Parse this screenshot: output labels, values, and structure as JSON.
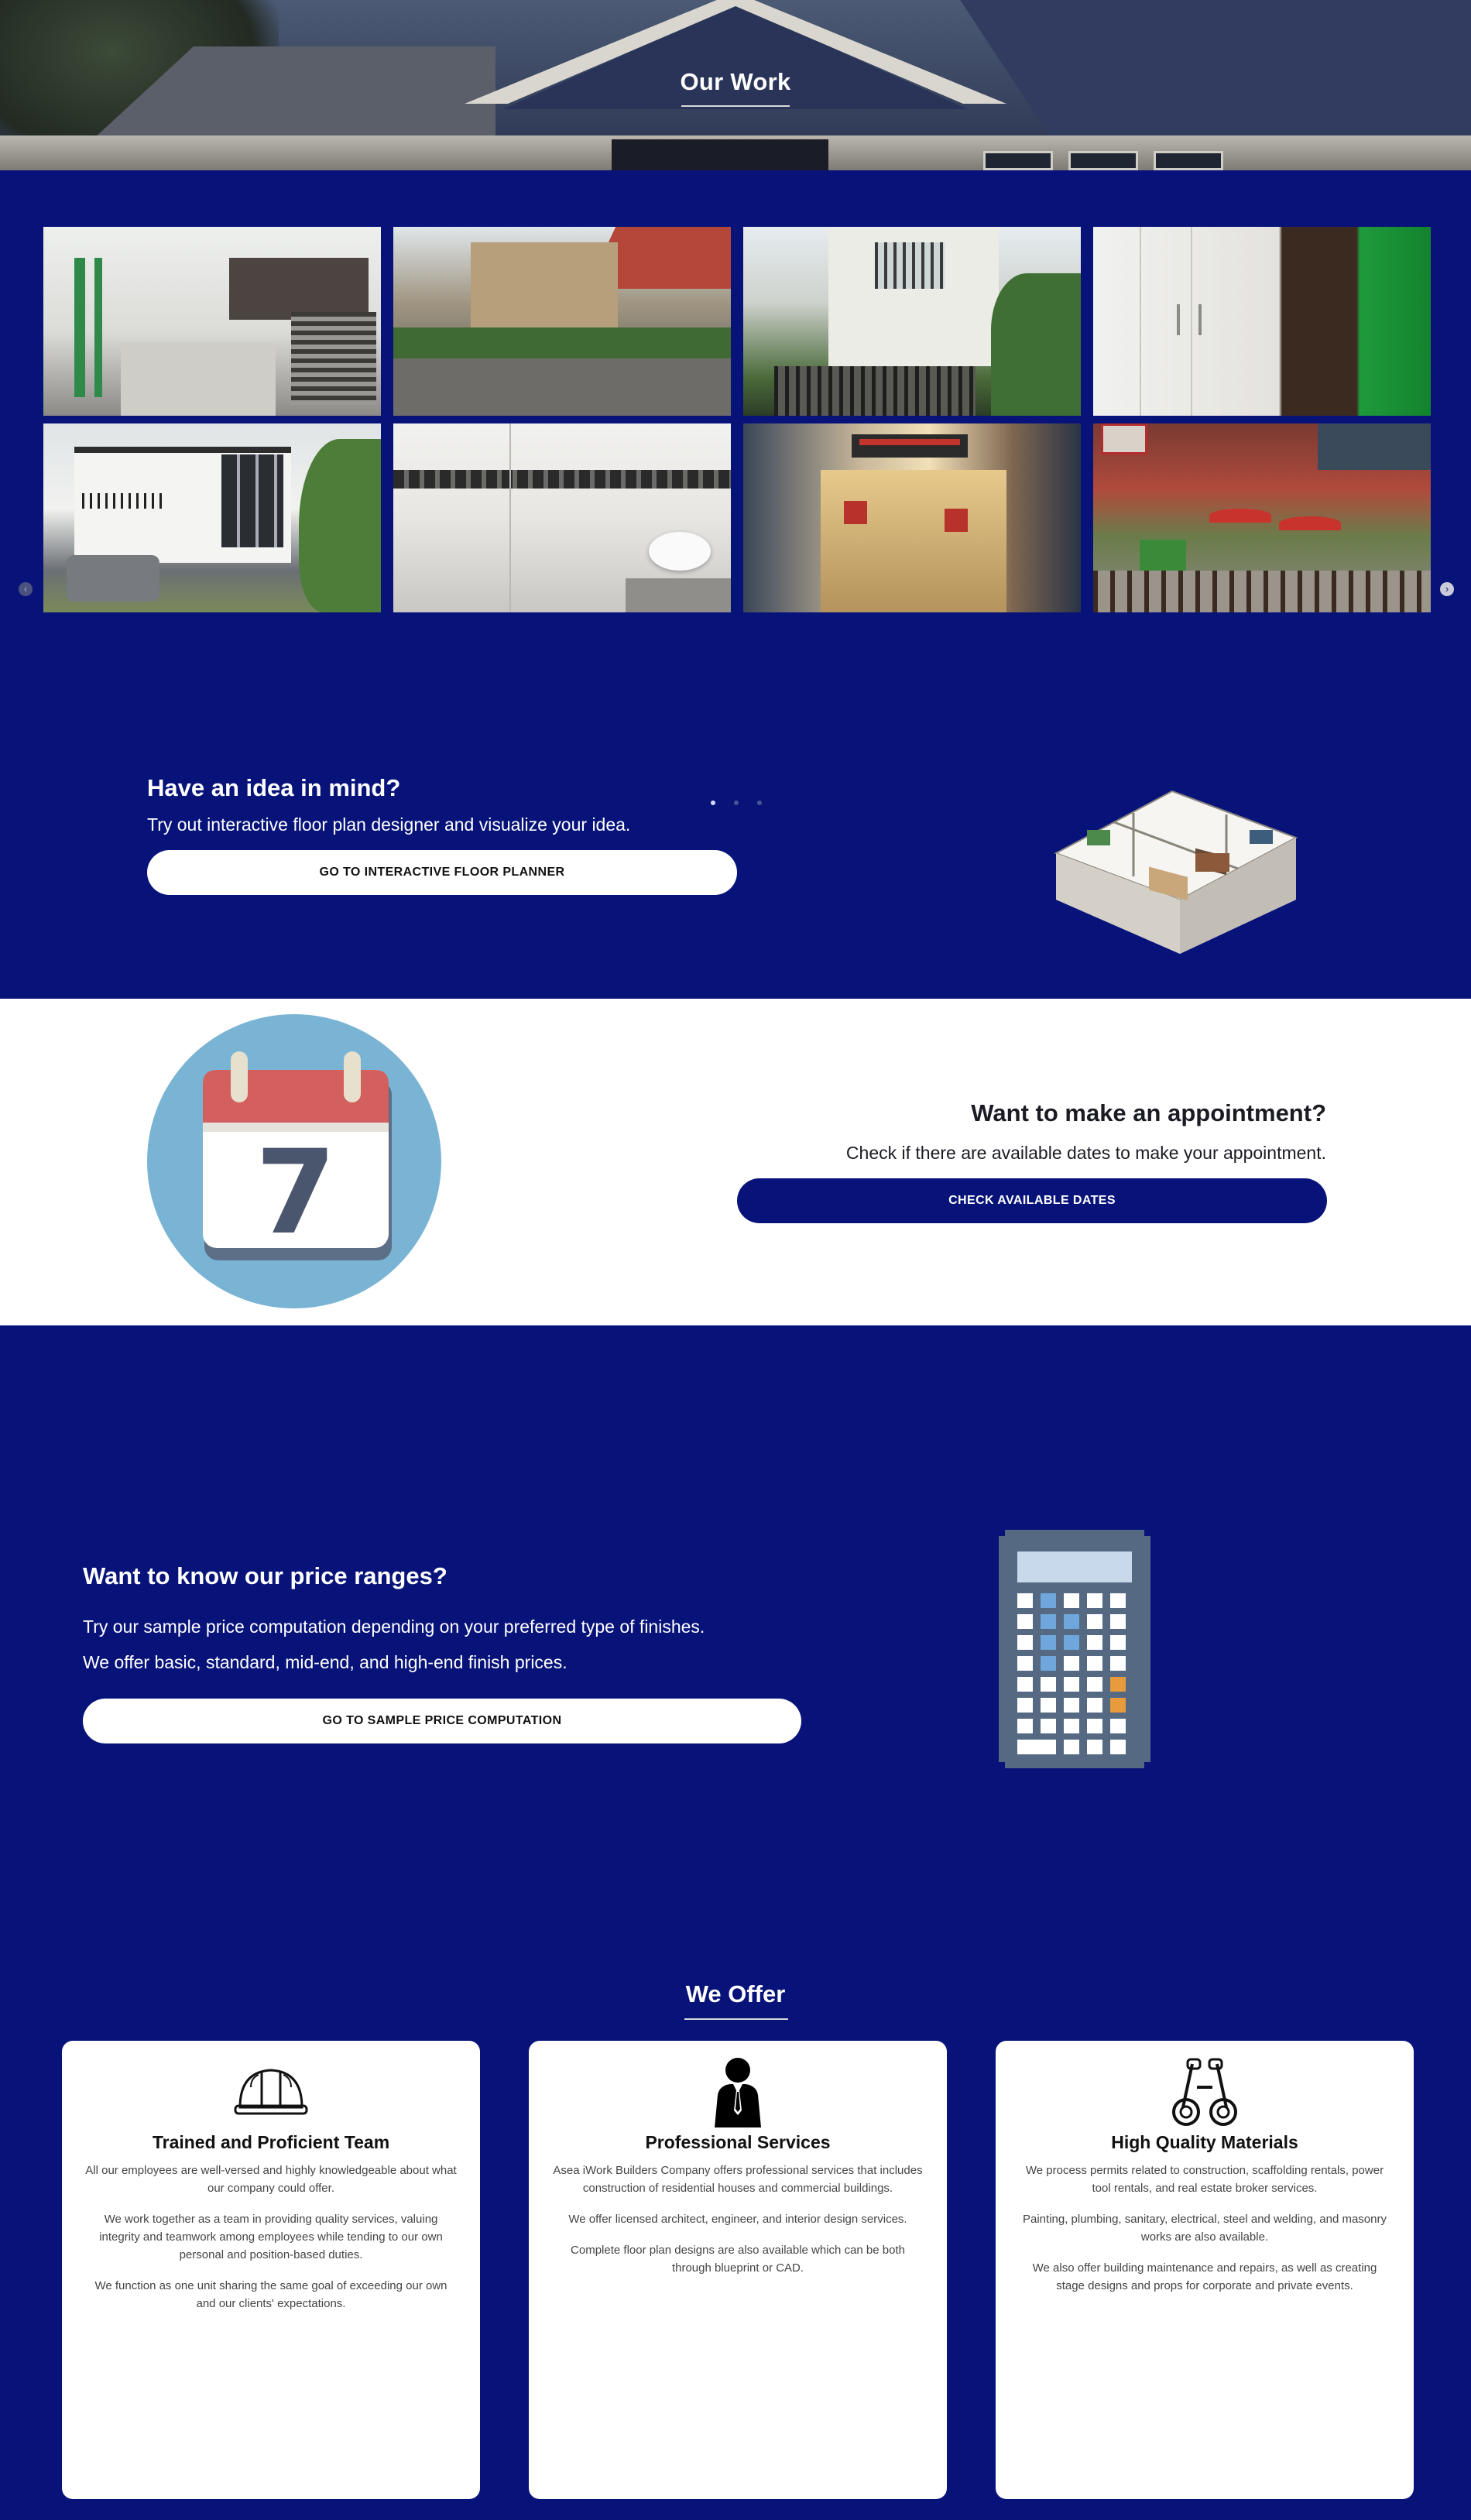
{
  "hero": {
    "title": "Our Work"
  },
  "gallery": {
    "prev_icon": "‹",
    "next_icon": "›",
    "images": [
      "kitchen-interior",
      "townhouse-street",
      "house-facade-with-palms",
      "interior-doors",
      "modern-two-storey-house",
      "bathroom-tiles",
      "korean-restaurant-storefront",
      "outdoor-restaurant-patio"
    ],
    "dots": 3,
    "active_dot": 0
  },
  "idea": {
    "title": "Have an idea in mind?",
    "subtitle": "Try out interactive floor plan designer and visualize your idea.",
    "button": "GO TO INTERACTIVE FLOOR PLANNER"
  },
  "appointment": {
    "calendar_day": "7",
    "title": "Want to make an appointment?",
    "subtitle": "Check if there are available dates to make your appointment.",
    "button": "CHECK AVAILABLE DATES"
  },
  "price": {
    "title": "Want to know our price ranges?",
    "line1": "Try our sample price computation depending on your preferred type of finishes.",
    "line2": "We offer basic, standard, mid-end, and high-end finish prices.",
    "button": "GO TO SAMPLE PRICE COMPUTATION"
  },
  "offer": {
    "title": "We Offer",
    "cards": [
      {
        "icon": "hard-hat-icon",
        "title": "Trained and Proficient Team",
        "paragraphs": [
          "All our employees are well-versed and highly knowledgeable about what our company could offer.",
          "We work together as a team in providing quality services, valuing integrity and teamwork among employees while tending to our own personal and position-based duties.",
          "We function as one unit sharing the same goal of exceeding our own and our clients' expectations."
        ]
      },
      {
        "icon": "professional-person-icon",
        "title": "Professional Services",
        "paragraphs": [
          "Asea iWork Builders Company offers professional services that includes construction of residential houses and commercial buildings.",
          "We offer licensed architect, engineer, and interior design services.",
          "Complete floor plan designs are also available which can be both through blueprint or CAD."
        ]
      },
      {
        "icon": "blueprint-rolls-icon",
        "title": "High Quality Materials",
        "paragraphs": [
          "We process permits related to construction, scaffolding rentals, power tool rentals, and real estate broker services.",
          "Painting, plumbing, sanitary, electrical, steel and welding, and masonry works are also available.",
          "We also offer building maintenance and repairs, as well as creating stage designs and props for corporate and private events."
        ]
      }
    ]
  },
  "colors": {
    "navy": "#08137a",
    "white": "#ffffff",
    "calendar_blue": "#7ab4d4",
    "calendar_red": "#d35f5f"
  }
}
